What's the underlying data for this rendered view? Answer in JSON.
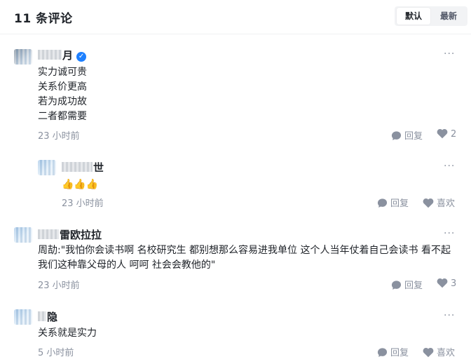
{
  "header": {
    "title": "11 条评论",
    "sort_default": "默认",
    "sort_latest": "最新"
  },
  "comments": [
    {
      "name": "月",
      "verified": true,
      "text": "实力诚可贵\n关系价更高\n若为成功故\n二者都需要",
      "time": "23 小时前",
      "reply_label": "回复",
      "like_label": "2"
    },
    {
      "name": "世",
      "text": "👍👍👍",
      "time": "23 小时前",
      "reply_label": "回复",
      "like_label": "喜欢"
    },
    {
      "name": "雷欧拉拉",
      "text": "周劼:\"我怕你会读书啊 名校研究生 都别想那么容易进我单位 这个人当年仗着自己会读书 看不起我们这种靠父母的人 呵呵 社会会教他的\"",
      "time": "23 小时前",
      "reply_label": "回复",
      "like_label": "3"
    },
    {
      "name": "隐",
      "text": "关系就是实力",
      "time": "5 小时前",
      "reply_label": "回复",
      "like_label": "喜欢"
    }
  ],
  "icons": {
    "verified": "verified-badge-icon",
    "reply": "comment-bubble-icon",
    "like": "heart-icon",
    "more": "more-dots-icon"
  },
  "colors": {
    "accent": "#1e80ff",
    "muted": "#8a919f",
    "text": "#1f2329"
  }
}
